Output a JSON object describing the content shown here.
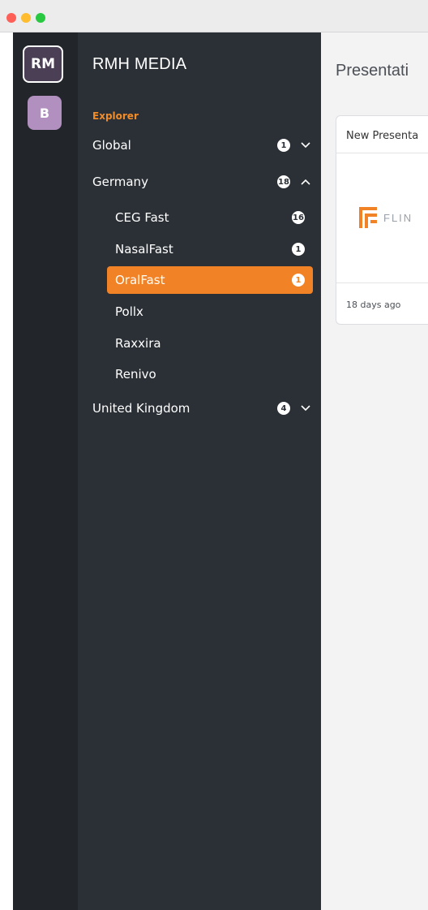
{
  "workspaces": [
    {
      "initials": "RM",
      "color": "#4a3f55"
    },
    {
      "initials": "B",
      "color": "#b18fbf"
    }
  ],
  "sidebar": {
    "org_name": "RMH MEDIA",
    "section_label": "Explorer",
    "groups": [
      {
        "label": "Global",
        "count": "1",
        "expanded": false
      },
      {
        "label": "Germany",
        "count": "18",
        "expanded": true,
        "children": [
          {
            "label": "CEG Fast",
            "count": "16"
          },
          {
            "label": "NasalFast",
            "count": "1"
          },
          {
            "label": "OralFast",
            "count": "1",
            "active": true
          },
          {
            "label": "Pollx",
            "count": ""
          },
          {
            "label": "Raxxira",
            "count": ""
          },
          {
            "label": "Renivo",
            "count": ""
          }
        ]
      },
      {
        "label": "United Kingdom",
        "count": "4",
        "expanded": false
      }
    ]
  },
  "main": {
    "title": "Presentati",
    "card": {
      "title": "New Presenta",
      "logo_text": "FLIN",
      "timestamp": "18 days ago"
    }
  },
  "colors": {
    "accent": "#f28226",
    "sidebar_bg": "#2b3036",
    "rail_bg": "#22262b"
  }
}
